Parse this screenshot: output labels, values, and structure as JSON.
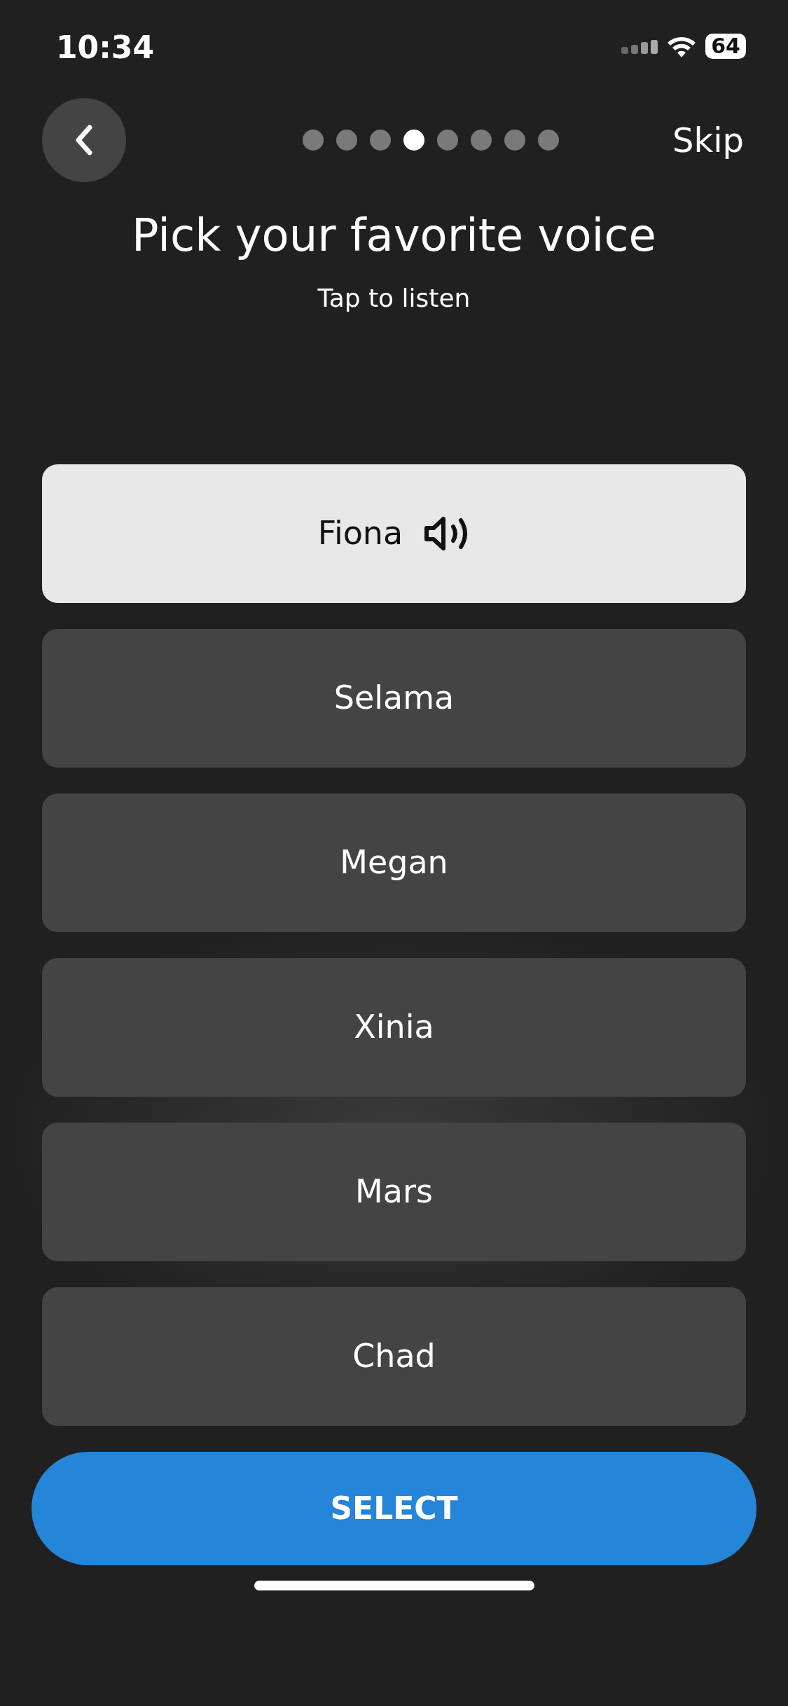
{
  "status_bar": {
    "time": "10:34",
    "battery": "64"
  },
  "header": {
    "skip": "Skip",
    "steps": [
      {
        "selected": false
      },
      {
        "selected": false
      },
      {
        "selected": false
      },
      {
        "selected": true
      },
      {
        "selected": false
      },
      {
        "selected": false
      },
      {
        "selected": false
      },
      {
        "selected": false
      }
    ]
  },
  "title": "Pick your favorite voice",
  "subtitle": "Tap to listen",
  "voices": [
    {
      "name": "Fiona",
      "selected": true
    },
    {
      "name": "Selama",
      "selected": false
    },
    {
      "name": "Megan",
      "selected": false
    },
    {
      "name": "Xinia",
      "selected": false
    },
    {
      "name": "Mars",
      "selected": false
    },
    {
      "name": "Chad",
      "selected": false
    }
  ],
  "select_button": "SELECT"
}
